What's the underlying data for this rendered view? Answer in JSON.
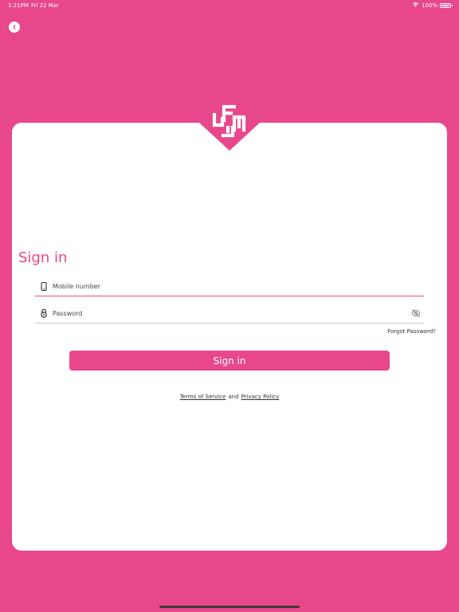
{
  "status_bar": {
    "time": "1:21PM",
    "date": "Fri 22 Mar",
    "battery": "100%",
    "battery_level": 1.0
  },
  "icons": {
    "back": "chevron-left-icon",
    "mobile": "smartphone-icon",
    "password": "lock-icon",
    "visibility": "eye-off-icon",
    "wifi": "wifi-icon",
    "battery": "battery-icon",
    "logo": "brand-logo"
  },
  "colors": {
    "brand": "#e8478c",
    "card": "#ffffff",
    "text": "#333333"
  },
  "login": {
    "title": "Sign in",
    "mobile_placeholder": "Mobile number",
    "mobile_value": "",
    "password_placeholder": "Password",
    "password_value": "",
    "forgot_label": "Forgot Password?",
    "submit_label": "Sign in"
  },
  "footer": {
    "terms_label": "Terms of Service",
    "and_label": "and",
    "privacy_label": "Privacy Policy"
  }
}
